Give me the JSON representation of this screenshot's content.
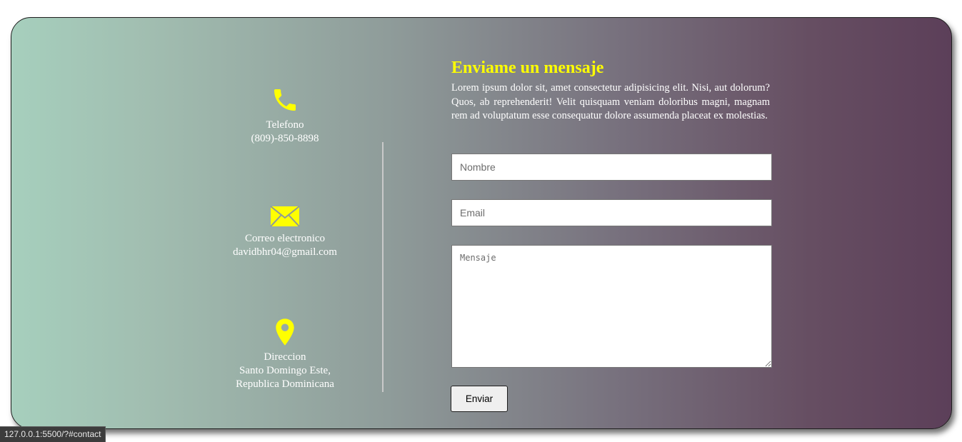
{
  "contact_info": {
    "phone": {
      "icon": "phone-icon",
      "label": "Telefono",
      "value": "(809)-850-8898"
    },
    "email": {
      "icon": "envelope-icon",
      "label": "Correo electronico",
      "value": "davidbhr04@gmail.com"
    },
    "address": {
      "icon": "map-pin-icon",
      "label": "Direccion",
      "line1": "Santo Domingo Este,",
      "line2": "Republica Dominicana"
    }
  },
  "form": {
    "title": "Enviame un mensaje",
    "description": "Lorem ipsum dolor sit, amet consectetur adipisicing elit. Nisi, aut dolorum? Quos, ab reprehenderit! Velit quisquam veniam doloribus magni, magnam rem ad voluptatum esse consequatur dolore assumenda placeat ex molestias.",
    "name_placeholder": "Nombre",
    "email_placeholder": "Email",
    "message_placeholder": "Mensaje",
    "submit_label": "Enviar"
  },
  "status_bar": {
    "url": "127.0.0.1:5500/?#contact"
  },
  "colors": {
    "accent": "#ffff00",
    "gradient_start": "#a6cfbd",
    "gradient_end": "#5c3f59"
  }
}
